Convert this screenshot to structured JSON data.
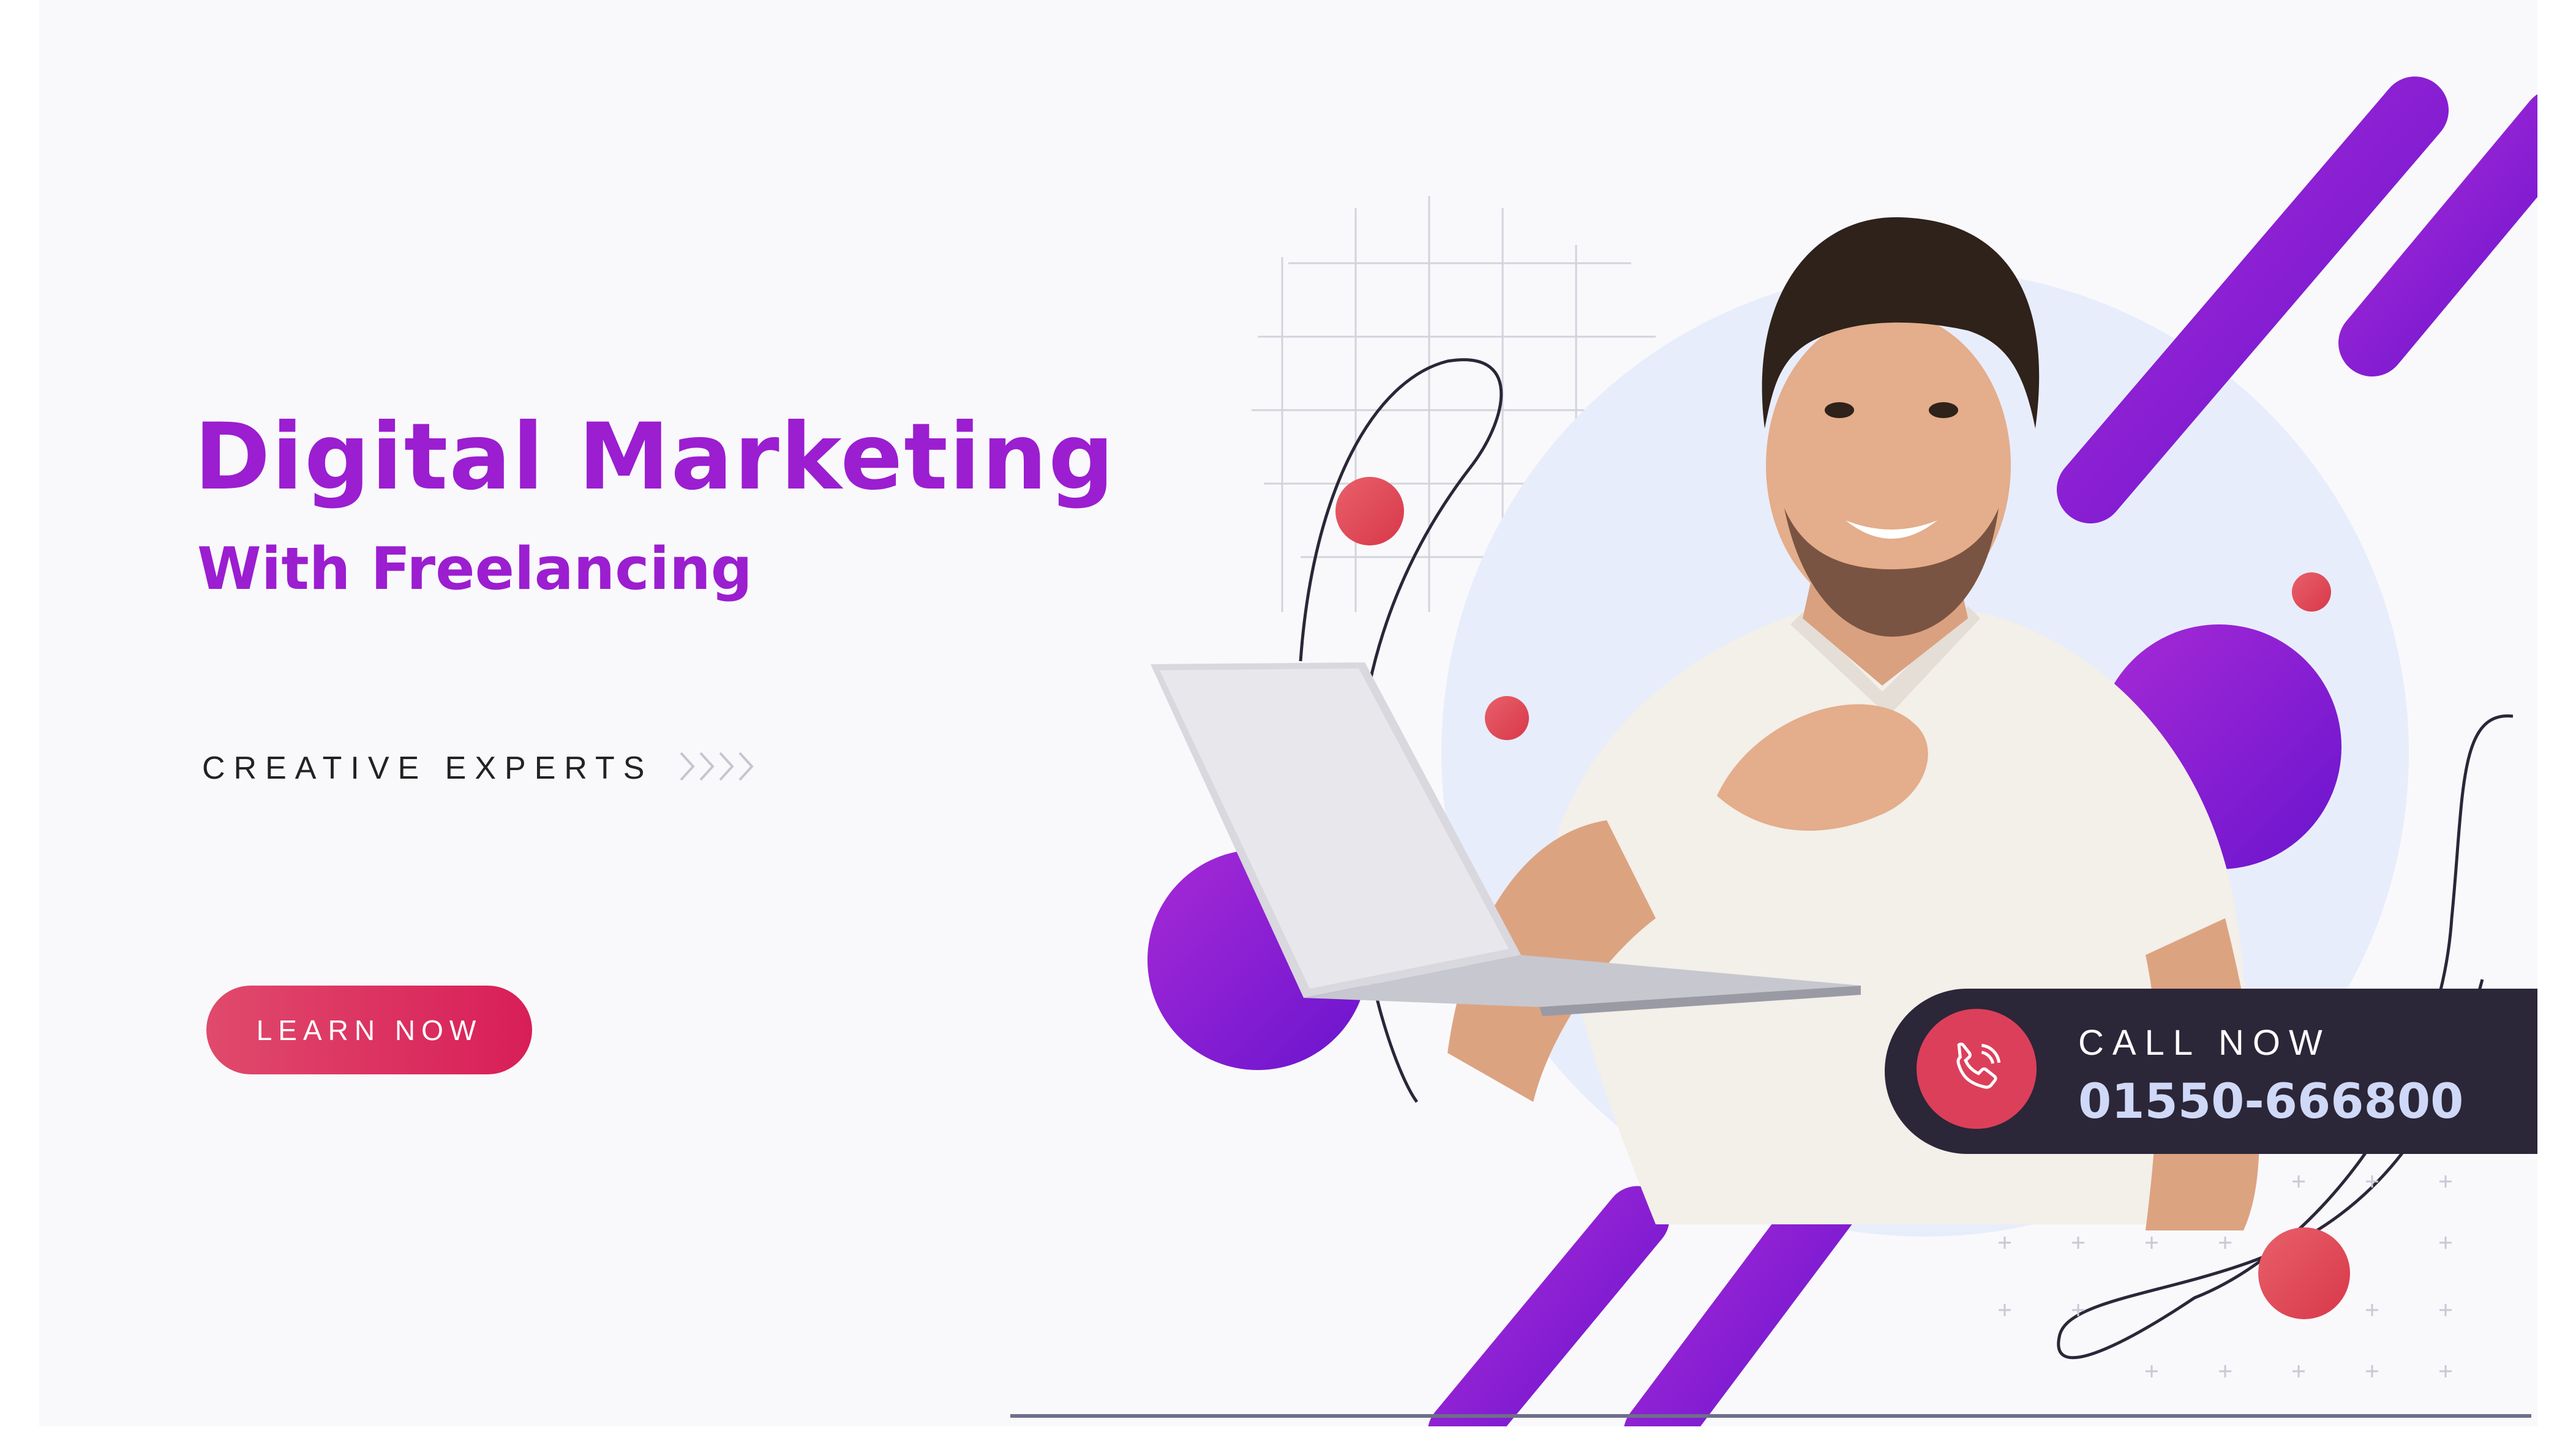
{
  "banner": {
    "headline": "Digital Marketing",
    "subheadline": "With Freelancing",
    "tagline": "CREATIVE EXPERTS",
    "cta_label": "LEARN NOW"
  },
  "call_box": {
    "label": "CALL NOW",
    "phone_number": "01550-666800"
  },
  "colors": {
    "brand_purple": "#9b1ed0",
    "accent_red": "#dc3f5a",
    "dark_panel": "#2b2638",
    "circle_bg": "#e8edfb"
  },
  "icons": [
    "phone-icon",
    "chevrons-right-icon"
  ]
}
